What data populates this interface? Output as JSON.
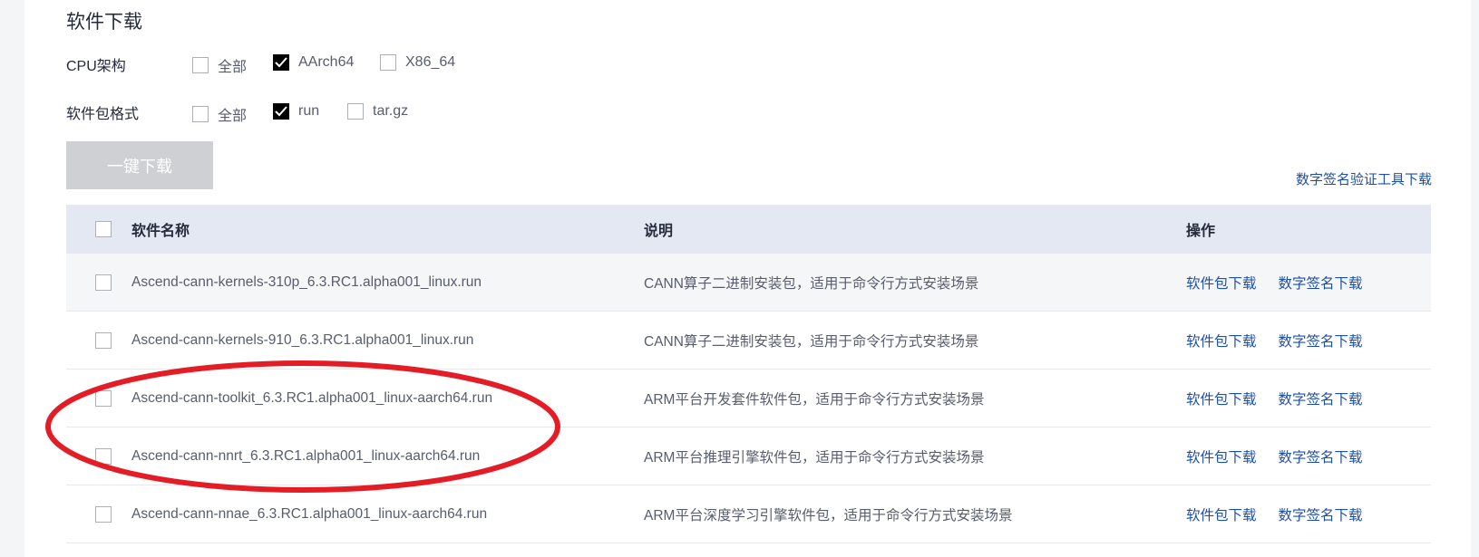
{
  "section_title": "软件下载",
  "filters": {
    "cpu": {
      "label": "CPU架构",
      "options": [
        {
          "label": "全部",
          "checked": false
        },
        {
          "label": "AArch64",
          "checked": true
        },
        {
          "label": "X86_64",
          "checked": false
        }
      ]
    },
    "format": {
      "label": "软件包格式",
      "options": [
        {
          "label": "全部",
          "checked": false
        },
        {
          "label": "run",
          "checked": true
        },
        {
          "label": "tar.gz",
          "checked": false
        }
      ]
    }
  },
  "one_click_download_label": "一键下载",
  "signature_tool_link": "数字签名验证工具下载",
  "table": {
    "headers": {
      "name": "软件名称",
      "desc": "说明",
      "op": "操作"
    },
    "rows": [
      {
        "name": "Ascend-cann-kernels-310p_6.3.RC1.alpha001_linux.run",
        "desc": "CANN算子二进制安装包，适用于命令行方式安装场景",
        "pkg_link": "软件包下载",
        "sig_link": "数字签名下载"
      },
      {
        "name": "Ascend-cann-kernels-910_6.3.RC1.alpha001_linux.run",
        "desc": "CANN算子二进制安装包，适用于命令行方式安装场景",
        "pkg_link": "软件包下载",
        "sig_link": "数字签名下载"
      },
      {
        "name": "Ascend-cann-toolkit_6.3.RC1.alpha001_linux-aarch64.run",
        "desc": "ARM平台开发套件软件包，适用于命令行方式安装场景",
        "pkg_link": "软件包下载",
        "sig_link": "数字签名下载"
      },
      {
        "name": "Ascend-cann-nnrt_6.3.RC1.alpha001_linux-aarch64.run",
        "desc": "ARM平台推理引擎软件包，适用于命令行方式安装场景",
        "pkg_link": "软件包下载",
        "sig_link": "数字签名下载"
      },
      {
        "name": "Ascend-cann-nnae_6.3.RC1.alpha001_linux-aarch64.run",
        "desc": "ARM平台深度学习引擎软件包，适用于命令行方式安装场景",
        "pkg_link": "软件包下载",
        "sig_link": "数字签名下载"
      }
    ]
  },
  "colors": {
    "link": "#1e4fa8",
    "header_bg": "#e3e8f3",
    "annotation_ellipse": "#e31c25"
  }
}
